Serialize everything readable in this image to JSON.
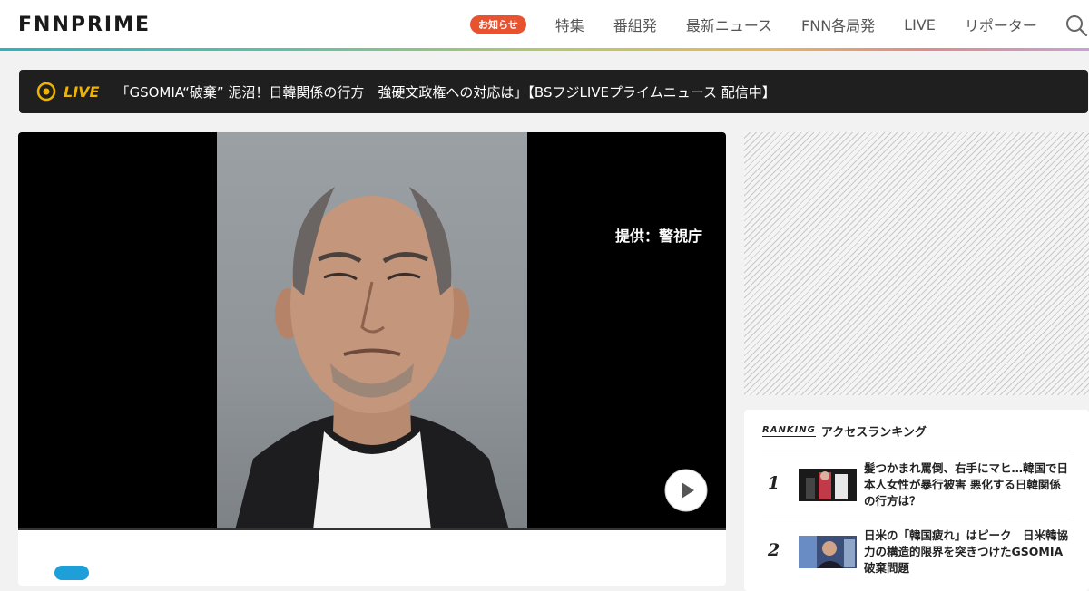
{
  "header": {
    "logo": "FNNPRIME",
    "notice_badge": "お知らせ",
    "nav": [
      "特集",
      "番組発",
      "最新ニュース",
      "FNN各局発",
      "LIVE",
      "リポーター"
    ]
  },
  "live_bar": {
    "label": "LIVE",
    "text": "「GSOMIA“破棄” 泥沼！日韓関係の行方　強硬文政権への対応は」【BSフジLIVEプライムニュース 配信中】"
  },
  "video": {
    "credit": "提供：警視庁"
  },
  "ranking": {
    "logo": "RANKING",
    "title": "アクセスランキング",
    "items": [
      {
        "rank": "1",
        "title": "髪つかまれ罵倒、右手にマヒ…韓国で日本人女性が暴行被害 悪化する日韓関係の行方は？"
      },
      {
        "rank": "2",
        "title": "日米の「韓国疲れ」はピーク　日米韓協力の構造的限界を突きつけたGSOMIA破棄問題"
      }
    ]
  },
  "colors": {
    "accent_live": "#f0b400",
    "notice": "#e8522f",
    "tag": "#1f9fd8"
  }
}
